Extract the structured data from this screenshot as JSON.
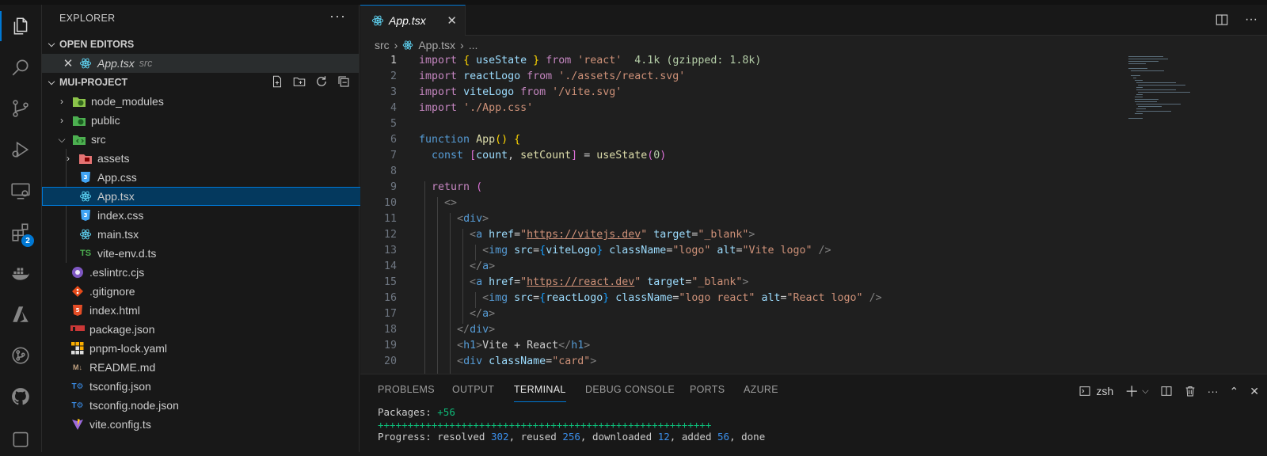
{
  "explorer": {
    "title": "EXPLORER",
    "more": "···",
    "open_editors_label": "OPEN EDITORS",
    "open_editor": {
      "name": "App.tsx",
      "desc": "src"
    },
    "project_label": "MUI-PROJECT",
    "tree": [
      {
        "name": "node_modules",
        "type": "folder"
      },
      {
        "name": "public",
        "type": "folder"
      },
      {
        "name": "src",
        "type": "folder-open"
      },
      {
        "name": "assets",
        "type": "folder"
      },
      {
        "name": "App.css",
        "type": "css"
      },
      {
        "name": "App.tsx",
        "type": "react"
      },
      {
        "name": "index.css",
        "type": "css"
      },
      {
        "name": "main.tsx",
        "type": "react"
      },
      {
        "name": "vite-env.d.ts",
        "type": "ts"
      },
      {
        "name": ".eslintrc.cjs",
        "type": "eslint"
      },
      {
        "name": ".gitignore",
        "type": "git"
      },
      {
        "name": "index.html",
        "type": "html"
      },
      {
        "name": "package.json",
        "type": "npm"
      },
      {
        "name": "pnpm-lock.yaml",
        "type": "pnpm"
      },
      {
        "name": "README.md",
        "type": "md"
      },
      {
        "name": "tsconfig.json",
        "type": "tsconfig"
      },
      {
        "name": "tsconfig.node.json",
        "type": "tsconfig"
      },
      {
        "name": "vite.config.ts",
        "type": "vite"
      }
    ]
  },
  "activity": {
    "extensions_badge": "2"
  },
  "tab": {
    "name": "App.tsx"
  },
  "breadcrumb": {
    "folder": "src",
    "file": "App.tsx",
    "rest": "..."
  },
  "code": {
    "line_numbers": [
      "1",
      "2",
      "3",
      "4",
      "5",
      "6",
      "7",
      "8",
      "9",
      "10",
      "11",
      "12",
      "13",
      "14",
      "15",
      "16",
      "17",
      "18",
      "19",
      "20"
    ],
    "import_cost": "4.1k (gzipped: 1.8k)"
  },
  "panel": {
    "tabs": [
      "PROBLEMS",
      "OUTPUT",
      "TERMINAL",
      "DEBUG CONSOLE",
      "PORTS",
      "AZURE"
    ],
    "shell": "zsh",
    "terminal": {
      "packages_label": "Packages:",
      "packages_value": "+56",
      "progress_bar": "++++++++++++++++++++++++++++++++++++++++++++++++++++++++",
      "progress_prefix": "Progress: resolved ",
      "resolved": "302",
      "reused_label": ", reused ",
      "reused": "256",
      "downloaded_label": ", downloaded ",
      "downloaded": "12",
      "added_label": ", added ",
      "added": "56",
      "done": ", done"
    }
  },
  "colors": {
    "accent": "#0078d4",
    "selection": "#04395e",
    "background": "#1f1f1f"
  }
}
